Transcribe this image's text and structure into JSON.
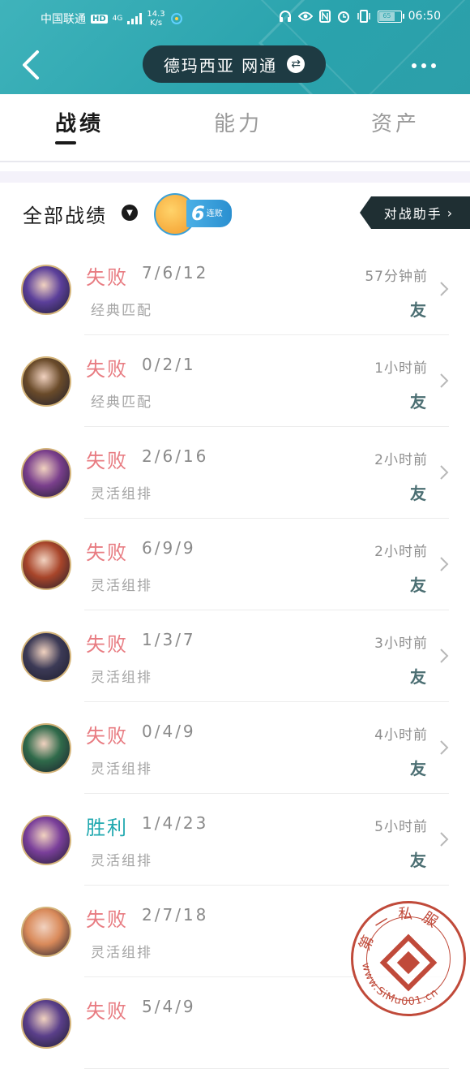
{
  "status_bar": {
    "carrier": "中国联通",
    "hd": "HD",
    "network": "4G",
    "speed_value": "14.3",
    "speed_unit": "K/s",
    "battery": "65",
    "time": "06:50"
  },
  "header": {
    "back_icon": "back-arrow-icon",
    "server": "德玛西亚 网通",
    "swap_icon": "swap-icon",
    "more_icon": "more-icon"
  },
  "tabs": [
    {
      "label": "战绩",
      "active": true
    },
    {
      "label": "能力",
      "active": false
    },
    {
      "label": "资产",
      "active": false
    }
  ],
  "filter": {
    "label": "全部战绩",
    "streak_number": "6",
    "streak_text": "连败",
    "assistant_label": "对战助手"
  },
  "matches": [
    {
      "result": "失败",
      "kda": "7/6/12",
      "mode": "经典匹配",
      "time": "57分钟前",
      "tag": "友",
      "win": false,
      "avatar_color": "#5b3f9a"
    },
    {
      "result": "失败",
      "kda": "0/2/1",
      "mode": "经典匹配",
      "time": "1小时前",
      "tag": "友",
      "win": false,
      "avatar_color": "#6a4b2a"
    },
    {
      "result": "失败",
      "kda": "2/6/16",
      "mode": "灵活组排",
      "time": "2小时前",
      "tag": "友",
      "win": false,
      "avatar_color": "#7a3f8c"
    },
    {
      "result": "失败",
      "kda": "6/9/9",
      "mode": "灵活组排",
      "time": "2小时前",
      "tag": "友",
      "win": false,
      "avatar_color": "#a8452a"
    },
    {
      "result": "失败",
      "kda": "1/3/7",
      "mode": "灵活组排",
      "time": "3小时前",
      "tag": "友",
      "win": false,
      "avatar_color": "#3c3a56"
    },
    {
      "result": "失败",
      "kda": "0/4/9",
      "mode": "灵活组排",
      "time": "4小时前",
      "tag": "友",
      "win": false,
      "avatar_color": "#2f6a4a"
    },
    {
      "result": "胜利",
      "kda": "1/4/23",
      "mode": "灵活组排",
      "time": "5小时前",
      "tag": "友",
      "win": true,
      "avatar_color": "#7a3f9a"
    },
    {
      "result": "失败",
      "kda": "2/7/18",
      "mode": "灵活组排",
      "time": "",
      "tag": "",
      "win": false,
      "avatar_color": "#d98a5a"
    },
    {
      "result": "失败",
      "kda": "5/4/9",
      "mode": "",
      "time": "",
      "tag": "",
      "win": false,
      "avatar_color": "#5a3f8a"
    }
  ],
  "watermark": {
    "top_text": "第一私服",
    "bottom_text": "www.SiMu001.cn",
    "color": "#c04a3a"
  },
  "colors": {
    "header": "#2aa3ad",
    "lose": "#e87c82",
    "win": "#22a9b0"
  }
}
